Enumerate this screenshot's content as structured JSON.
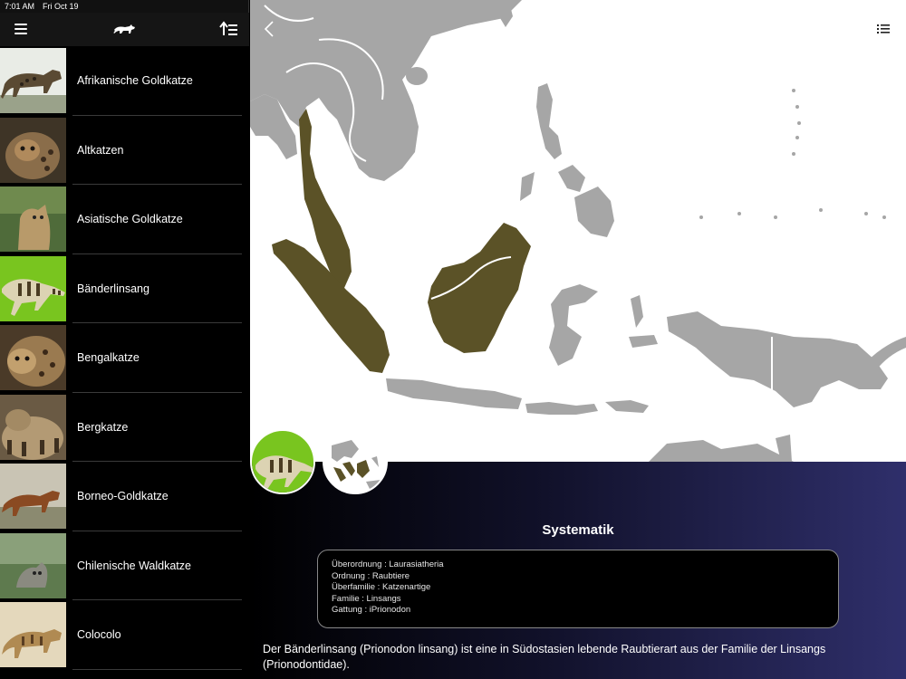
{
  "status_bar": {
    "time": "7:01 AM",
    "date": "Fri Oct 19"
  },
  "sidebar": {
    "items": [
      {
        "label": "Afrikanische Goldkatze"
      },
      {
        "label": "Altkatzen"
      },
      {
        "label": "Asiatische Goldkatze"
      },
      {
        "label": "Bänderlinsang"
      },
      {
        "label": "Bengalkatze"
      },
      {
        "label": "Bergkatze"
      },
      {
        "label": "Borneo-Goldkatze"
      },
      {
        "label": "Chilenische Waldkatze"
      },
      {
        "label": "Colocolo"
      }
    ]
  },
  "icons": {
    "menu": "hamburger-icon",
    "logo": "cat-silhouette-icon",
    "sort": "sort-icon",
    "back": "chevron-left-icon",
    "list": "list-icon"
  },
  "colors": {
    "range_fill": "#5b5227",
    "land": "#a6a6a6",
    "border_line": "#ffffff"
  },
  "detail": {
    "section_title": "Systematik",
    "taxonomy": [
      "Überordnung : Laurasiatheria",
      "Ordnung : Raubtiere",
      "Überfamilie : Katzenartige",
      "Familie : Linsangs",
      "Gattung : iPrionodon"
    ],
    "description": "Der Bänderlinsang (Prionodon linsang) ist eine in Südostasien lebende Raubtierart aus der Familie der Linsangs (Prionodontidae)."
  }
}
